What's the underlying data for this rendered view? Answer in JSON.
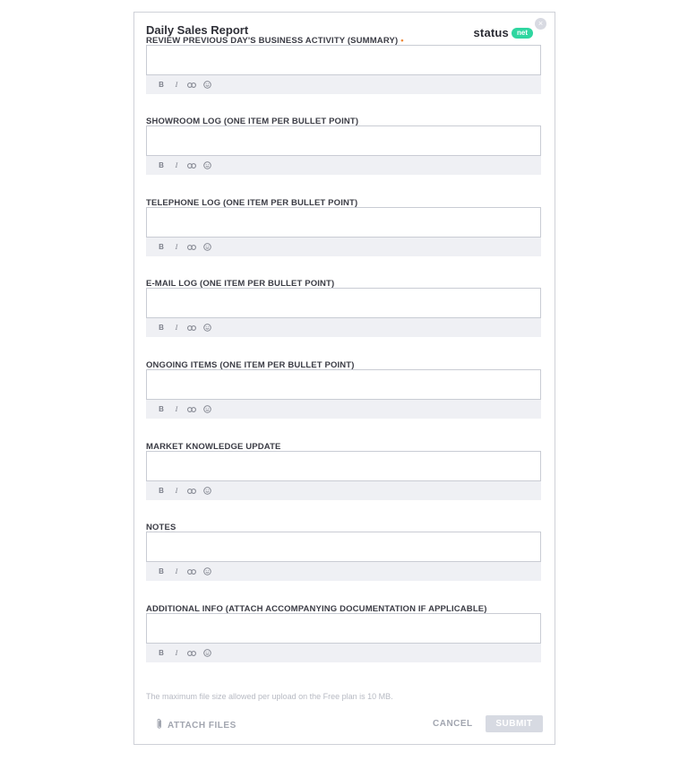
{
  "form": {
    "title": "Daily Sales Report",
    "brand": {
      "word": "status",
      "pill": "net"
    },
    "close_symbol": "×",
    "required_marker": "•",
    "fields": [
      {
        "label": "REVIEW PREVIOUS DAY'S BUSINESS ACTIVITY (SUMMARY)",
        "required": true,
        "value": ""
      },
      {
        "label": "SHOWROOM LOG (ONE ITEM PER BULLET POINT)",
        "required": false,
        "value": ""
      },
      {
        "label": "TELEPHONE LOG (ONE ITEM PER BULLET POINT)",
        "required": false,
        "value": ""
      },
      {
        "label": "E-MAIL LOG (ONE ITEM PER BULLET POINT)",
        "required": false,
        "value": ""
      },
      {
        "label": "ONGOING ITEMS (ONE ITEM PER BULLET POINT)",
        "required": false,
        "value": ""
      },
      {
        "label": "MARKET KNOWLEDGE UPDATE",
        "required": false,
        "value": ""
      },
      {
        "label": "NOTES",
        "required": false,
        "value": ""
      },
      {
        "label": "ADDITIONAL INFO (ATTACH ACCOMPANYING DOCUMENTATION IF APPLICABLE)",
        "required": false,
        "value": ""
      }
    ],
    "toolbar": {
      "bold": "B",
      "italic": "I",
      "link_icon": "link-icon",
      "emoji_icon": "smiley-icon"
    },
    "upload_note": "The maximum file size allowed per upload on the Free plan is 10 MB.",
    "attach_label": "ATTACH FILES",
    "attach_icon": "paperclip-icon",
    "cancel_label": "CANCEL",
    "submit_label": "SUBMIT"
  }
}
